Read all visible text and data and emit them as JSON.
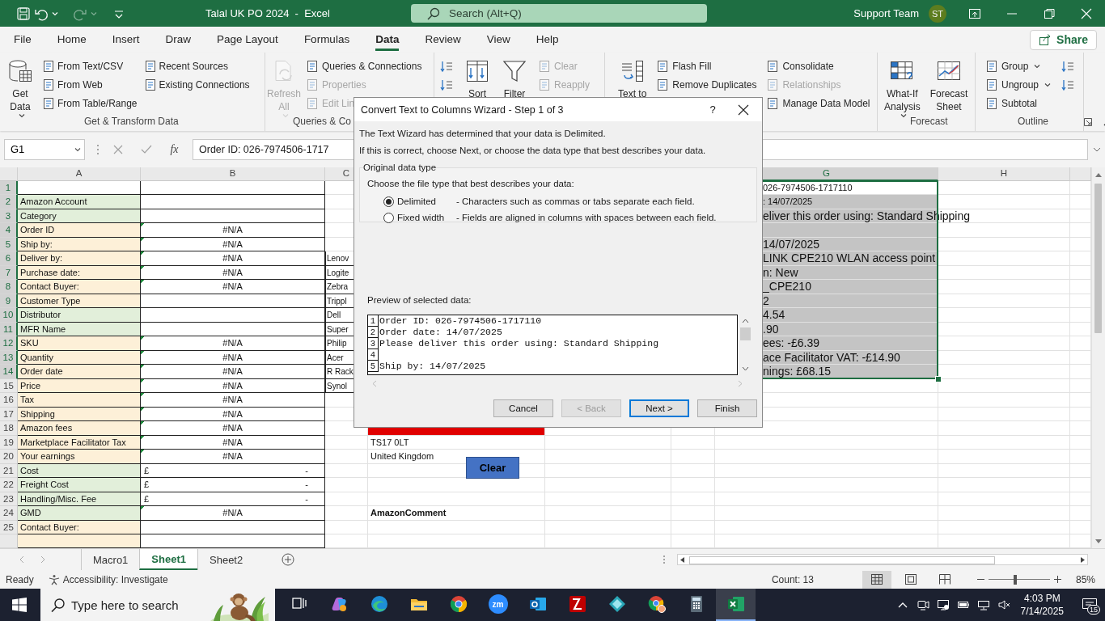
{
  "title_bar": {
    "quick_access": [
      {
        "kind": "save",
        "disabled": false
      },
      {
        "kind": "undo",
        "disabled": false
      },
      {
        "kind": "redo",
        "disabled": true
      },
      {
        "kind": "customize",
        "disabled": false
      }
    ],
    "title": "Talal UK PO 2024  -  Excel",
    "search": {
      "placeholder": "Search (Alt+Q)"
    },
    "user": "Support Team",
    "avatar": "ST"
  },
  "menu_tabs": [
    {
      "label": "File",
      "selected": false
    },
    {
      "label": "Home",
      "selected": false
    },
    {
      "label": "Insert",
      "selected": false
    },
    {
      "label": "Draw",
      "selected": false
    },
    {
      "label": "Page Layout",
      "selected": false
    },
    {
      "label": "Formulas",
      "selected": false
    },
    {
      "label": "Data",
      "selected": true
    },
    {
      "label": "Review",
      "selected": false
    },
    {
      "label": "View",
      "selected": false
    },
    {
      "label": "Help",
      "selected": false
    }
  ],
  "share": "Share",
  "ribbon": {
    "groups": [
      {
        "label": "Get & Transform Data",
        "columns": [
          [
            {
              "kind": "large",
              "label": "Get Data",
              "menu": true,
              "disabled": false
            }
          ],
          [
            {
              "kind": "small",
              "label": "From Text/CSV",
              "disabled": false
            },
            {
              "kind": "small",
              "label": "From Web",
              "disabled": false
            },
            {
              "kind": "small",
              "label": "From Table/Range",
              "disabled": false
            }
          ],
          [
            {
              "kind": "small",
              "label": "Recent Sources",
              "disabled": false
            },
            {
              "kind": "small",
              "label": "Existing Connections",
              "disabled": false
            }
          ]
        ]
      },
      {
        "label": "Queries & Co",
        "columns": [
          [
            {
              "kind": "large",
              "label": "Refresh All",
              "menu": true,
              "disabled": true
            }
          ],
          [
            {
              "kind": "small",
              "label": "Queries & Connections",
              "disabled": false
            },
            {
              "kind": "small",
              "label": "Properties",
              "disabled": true
            },
            {
              "kind": "small",
              "label": "Edit Lin",
              "disabled": true
            }
          ]
        ]
      },
      {
        "columns": [
          [
            {
              "kind": "icon",
              "disabled": false
            },
            {
              "kind": "icon",
              "disabled": false
            }
          ],
          [
            {
              "kind": "large",
              "label": "Sort",
              "disabled": false
            }
          ],
          [
            {
              "kind": "large",
              "label": "Filter",
              "disabled": false
            }
          ],
          [
            {
              "kind": "small",
              "label": "Clear",
              "disabled": true
            },
            {
              "kind": "small",
              "label": "Reapply",
              "disabled": true
            }
          ]
        ]
      },
      {
        "columns": [
          [
            {
              "kind": "large",
              "label": "Text to",
              "disabled": false
            }
          ],
          [
            {
              "kind": "small",
              "label": "Flash Fill",
              "disabled": false
            },
            {
              "kind": "small",
              "label": "Remove Duplicates",
              "disabled": false
            }
          ],
          [
            {
              "kind": "small",
              "label": "Consolidate",
              "disabled": false
            },
            {
              "kind": "small",
              "label": "Relationships",
              "disabled": true
            },
            {
              "kind": "small",
              "label": "Manage Data Model",
              "disabled": false
            }
          ]
        ]
      },
      {
        "label": "Forecast",
        "columns": [
          [
            {
              "kind": "large",
              "label": "What-If Analysis",
              "menu": true,
              "disabled": false
            }
          ],
          [
            {
              "kind": "large",
              "label": "Forecast Sheet",
              "disabled": false
            }
          ]
        ]
      },
      {
        "label": "Outline",
        "columns": [
          [
            {
              "kind": "small",
              "label": "Group",
              "menu": true,
              "disabled": false
            },
            {
              "kind": "small",
              "label": "Ungroup",
              "menu": true,
              "disabled": false
            },
            {
              "kind": "small",
              "label": "Subtotal",
              "disabled": false
            }
          ],
          [
            {
              "kind": "icon",
              "disabled": false
            },
            {
              "kind": "icon",
              "disabled": false
            }
          ]
        ]
      }
    ]
  },
  "formula_bar": {
    "name_box": "G1",
    "function_label": "fx",
    "formula": "Order ID: 026-7974506-1717"
  },
  "sheet": {
    "columns": [
      {
        "label": "A",
        "selected": false
      },
      {
        "label": "B",
        "selected": false
      },
      {
        "label": "C",
        "selected": false
      },
      {
        "label": "G",
        "selected": true
      },
      {
        "label": "H",
        "selected": false
      }
    ],
    "rows": [
      {
        "number": "1",
        "selected": true,
        "g": {
          "text": "026-7974506-1717110",
          "kind": "small",
          "color": "#ffffff"
        }
      },
      {
        "number": "2",
        "selected": true,
        "a": {
          "text": "Amazon Account",
          "color": "#e2efda"
        },
        "b": {
          "flag": false
        },
        "g": {
          "text": ": 14/07/2025",
          "kind": "small",
          "color": "#c4c4c4"
        }
      },
      {
        "number": "3",
        "selected": true,
        "a": {
          "text": "Category",
          "color": "#e2efda"
        },
        "b": {
          "flag": false
        },
        "g": {
          "text": "eliver this order using: Standard Shipping",
          "kind": "large",
          "color": "#c4c4c4"
        }
      },
      {
        "number": "4",
        "selected": true,
        "a": {
          "text": "Order ID",
          "color": "#fdf0d8"
        },
        "b": {
          "text": "#N/A",
          "flag": true
        },
        "g": {
          "kind": "large",
          "color": "#c4c4c4"
        }
      },
      {
        "number": "5",
        "selected": true,
        "a": {
          "text": "Ship by:",
          "color": "#fdf0d8"
        },
        "b": {
          "text": "#N/A",
          "flag": true
        },
        "g": {
          "text": "14/07/2025",
          "kind": "large",
          "color": "#c4c4c4"
        }
      },
      {
        "number": "6",
        "selected": true,
        "a": {
          "text": "Deliver by:",
          "color": "#fdf0d8"
        },
        "b": {
          "text": "#N/A",
          "flag": true
        },
        "c": {
          "text": "Lenov"
        },
        "g": {
          "text": "LINK CPE210 WLAN access point",
          "kind": "large",
          "color": "#c4c4c4"
        }
      },
      {
        "number": "7",
        "selected": true,
        "a": {
          "text": "Purchase date:",
          "color": "#fdf0d8"
        },
        "b": {
          "text": "#N/A",
          "flag": true
        },
        "c": {
          "text": "Logite"
        },
        "g": {
          "text": "n: New",
          "kind": "large",
          "color": "#c4c4c4"
        }
      },
      {
        "number": "8",
        "selected": true,
        "a": {
          "text": "Contact Buyer:",
          "color": "#fdf0d8"
        },
        "b": {
          "text": "#N/A",
          "flag": true
        },
        "c": {
          "text": "Zebra"
        },
        "g": {
          "text": "_CPE210",
          "kind": "large",
          "color": "#c4c4c4"
        }
      },
      {
        "number": "9",
        "selected": true,
        "a": {
          "text": "Customer Type",
          "color": "#fdf0d8"
        },
        "b": {
          "flag": false
        },
        "c": {
          "text": "Trippl"
        },
        "g": {
          "text": "2",
          "kind": "large",
          "color": "#c4c4c4"
        }
      },
      {
        "number": "10",
        "selected": true,
        "a": {
          "text": "Distributor",
          "color": "#e2efda"
        },
        "b": {
          "flag": false
        },
        "c": {
          "text": "Dell"
        },
        "g": {
          "text": "4.54",
          "kind": "large",
          "color": "#c4c4c4"
        }
      },
      {
        "number": "11",
        "selected": true,
        "a": {
          "text": "MFR Name",
          "color": "#e2efda"
        },
        "b": {
          "flag": false
        },
        "c": {
          "text": "Super"
        },
        "g": {
          "text": ".90",
          "kind": "large",
          "color": "#c4c4c4"
        }
      },
      {
        "number": "12",
        "selected": true,
        "a": {
          "text": "SKU",
          "color": "#fdf0d8"
        },
        "b": {
          "text": "#N/A",
          "flag": true
        },
        "c": {
          "text": "Philip"
        },
        "g": {
          "text": "ees: -£6.39",
          "kind": "large",
          "color": "#c4c4c4"
        }
      },
      {
        "number": "13",
        "selected": true,
        "a": {
          "text": "Quantity",
          "color": "#fdf0d8"
        },
        "b": {
          "text": "#N/A",
          "flag": true
        },
        "c": {
          "text": "Acer"
        },
        "g": {
          "text": "ace Facilitator VAT: -£14.90",
          "kind": "large",
          "color": "#c4c4c4"
        }
      },
      {
        "number": "14",
        "selected": true,
        "a": {
          "text": "Order date",
          "color": "#fdf0d8"
        },
        "b": {
          "text": "#N/A",
          "flag": true
        },
        "c": {
          "text": "R Rack"
        },
        "g": {
          "text": "nings: £68.15",
          "kind": "large",
          "color": "#c4c4c4"
        }
      },
      {
        "number": "15",
        "selected": false,
        "a": {
          "text": "Price",
          "color": "#fdf0d8"
        },
        "b": {
          "text": "#N/A",
          "flag": true
        },
        "c": {
          "text": "Synol"
        }
      },
      {
        "number": "16",
        "selected": false,
        "a": {
          "text": "Tax",
          "color": "#fdf0d8"
        },
        "b": {
          "text": "#N/A",
          "flag": true
        }
      },
      {
        "number": "17",
        "selected": false,
        "a": {
          "text": "Shipping",
          "color": "#fdf0d8"
        },
        "b": {
          "text": "#N/A",
          "flag": true
        }
      },
      {
        "number": "18",
        "selected": false,
        "a": {
          "text": "Amazon fees",
          "color": "#fdf0d8"
        },
        "b": {
          "text": "#N/A",
          "flag": true
        },
        "d": {
          "color": "#e00000"
        }
      },
      {
        "number": "19",
        "selected": false,
        "a": {
          "text": "Marketplace Facilitator Tax",
          "color": "#fdf0d8"
        },
        "b": {
          "text": "#N/A",
          "flag": true
        },
        "d": {
          "text": "TS17 0LT"
        }
      },
      {
        "number": "20",
        "selected": false,
        "a": {
          "text": "Your earnings",
          "color": "#fdf0d8"
        },
        "b": {
          "text": "#N/A",
          "flag": true
        },
        "d": {
          "text": "United Kingdom"
        }
      },
      {
        "number": "21",
        "selected": false,
        "a": {
          "text": "Cost",
          "color": "#e2efda"
        },
        "b": {
          "currency": "£",
          "text": "-",
          "flag": false
        }
      },
      {
        "number": "22",
        "selected": false,
        "a": {
          "text": "Freight Cost",
          "color": "#e2efda"
        },
        "b": {
          "currency": "£",
          "text": "-",
          "flag": false
        }
      },
      {
        "number": "23",
        "selected": false,
        "a": {
          "text": "Handling/Misc. Fee",
          "color": "#e2efda"
        },
        "b": {
          "currency": "£",
          "text": "-",
          "flag": false
        }
      },
      {
        "number": "24",
        "selected": false,
        "a": {
          "text": "GMD",
          "color": "#e2efda"
        },
        "b": {
          "text": "#N/A",
          "flag": true
        },
        "d": {
          "text": "AmazonComment",
          "kind": "heading"
        }
      },
      {
        "number": "25",
        "selected": false,
        "a": {
          "text": "Contact Buyer:",
          "color": "#fdf0d8"
        },
        "b": {
          "flag": false
        }
      },
      {
        "selected": false,
        "a": {
          "color": "#fdf0d8"
        },
        "b": {
          "flag": false
        }
      }
    ],
    "clear_button": "Clear"
  },
  "wizard": {
    "title": "Convert Text to Columns Wizard - Step 1 of 3",
    "help": "?",
    "intro": "The Text Wizard has determined that your data is Delimited.",
    "hint": "If this is correct, choose Next, or choose the data type that best describes your data.",
    "group_title": "Original data type",
    "prompt": "Choose the file type that best describes your data:",
    "options": [
      {
        "label": "Delimited",
        "description": "- Characters such as commas or tabs separate each field.",
        "selected": true
      },
      {
        "label": "Fixed width",
        "description": "- Fields are aligned in columns with spaces between each field.",
        "selected": false
      }
    ],
    "preview_title": "Preview of selected data:",
    "preview_lines": [
      {
        "number": "1",
        "text": "Order ID: 026-7974506-1717110"
      },
      {
        "number": "2",
        "text": "Order date: 14/07/2025"
      },
      {
        "number": "3",
        "text": "Please deliver this order using: Standard Shipping"
      },
      {
        "number": "4"
      },
      {
        "number": "5",
        "text": "Ship by: 14/07/2025"
      }
    ],
    "buttons": [
      {
        "label": "Cancel",
        "disabled": false,
        "default": false
      },
      {
        "label": "< Back",
        "disabled": true,
        "default": false
      },
      {
        "label": "Next >",
        "disabled": false,
        "default": true
      },
      {
        "label": "Finish",
        "disabled": false,
        "default": false
      }
    ]
  },
  "sheet_tabs": [
    {
      "label": "Macro1",
      "selected": false
    },
    {
      "label": "Sheet1",
      "selected": true
    },
    {
      "label": "Sheet2",
      "selected": false
    }
  ],
  "status_bar": {
    "ready": "Ready",
    "accessibility": "Accessibility: Investigate",
    "count": "Count: 13",
    "views": [
      {
        "kind": "normal",
        "selected": true
      },
      {
        "kind": "page-layout",
        "selected": false
      },
      {
        "kind": "page-break",
        "selected": false
      }
    ],
    "zoom": {
      "level": 0.43,
      "reading": "85%"
    }
  },
  "taskbar": {
    "search": {
      "placeholder": "Type here to search"
    },
    "apps": [
      {
        "kind": "task-view",
        "selected": false
      },
      {
        "kind": "copilot",
        "selected": false
      },
      {
        "kind": "edge",
        "selected": false
      },
      {
        "kind": "explorer",
        "selected": false
      },
      {
        "kind": "chrome",
        "selected": false
      },
      {
        "kind": "zoom",
        "label": "zm",
        "selected": false
      },
      {
        "kind": "outlook",
        "selected": false
      },
      {
        "kind": "filezilla",
        "selected": false
      },
      {
        "kind": "diamond",
        "selected": false
      },
      {
        "kind": "chrome-profile",
        "selected": false
      },
      {
        "kind": "calculator",
        "selected": false
      },
      {
        "kind": "excel",
        "selected": true
      }
    ],
    "time": "4:03 PM",
    "date": "7/14/2025",
    "notifications": "15"
  }
}
